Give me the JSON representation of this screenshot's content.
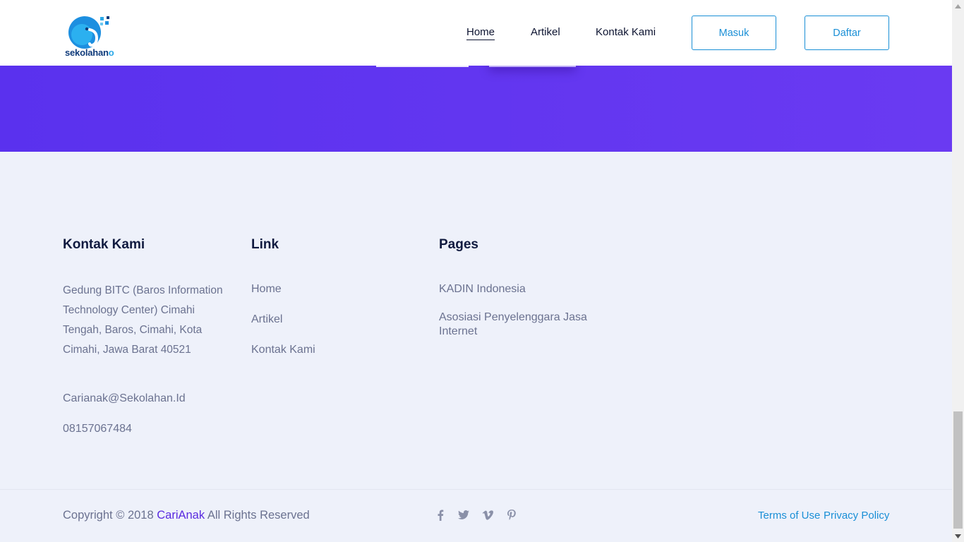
{
  "logo": {
    "text_main": "sekolahan",
    "text_accent": "o"
  },
  "nav": {
    "links": [
      "Home",
      "Artikel",
      "Kontak Kami"
    ],
    "login_label": "Masuk",
    "register_label": "Daftar"
  },
  "footer": {
    "contact": {
      "heading": "Kontak Kami",
      "address": "Gedung BITC (Baros Information Technology Center) Cimahi Tengah, Baros, Cimahi, Kota Cimahi, Jawa Barat 40521",
      "email": "Carianak@Sekolahan.Id",
      "phone": "08157067484"
    },
    "link": {
      "heading": "Link",
      "items": [
        "Home",
        "Artikel",
        "Kontak Kami"
      ]
    },
    "pages": {
      "heading": "Pages",
      "items": [
        "KADIN Indonesia",
        "Asosiasi Penyelenggara Jasa Internet"
      ]
    },
    "copyright": {
      "prefix": "Copyright © 2018",
      "brand": "CariAnak",
      "suffix": "All Rights Reserved"
    },
    "social_icons": [
      "facebook-icon",
      "twitter-icon",
      "vimeo-icon",
      "pinterest-icon"
    ],
    "legal": {
      "terms": "Terms of Use",
      "privacy": "Privacy Policy"
    }
  },
  "colors": {
    "purple_band": "#6236f0",
    "accent_blue": "#1a8fd6",
    "brand_purple": "#5a2be0",
    "footer_bg": "#eef1fa",
    "heading": "#101a3f"
  }
}
